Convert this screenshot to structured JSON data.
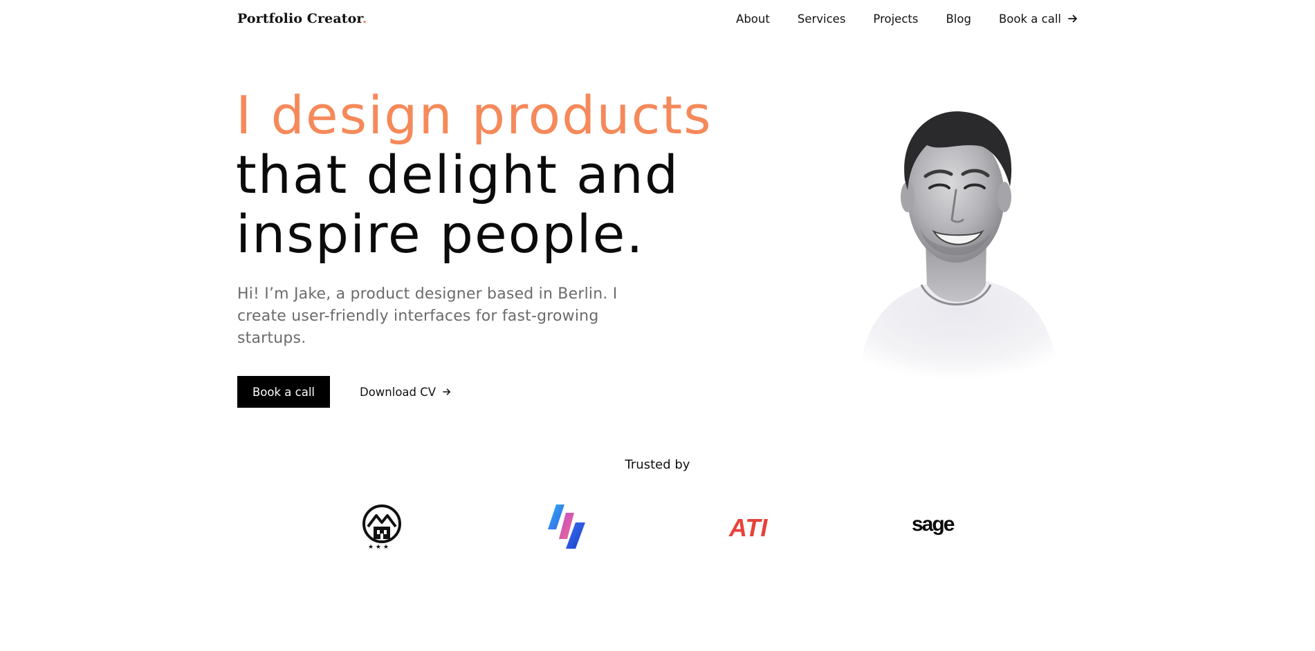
{
  "header": {
    "brand": "Portfolio Creator",
    "brand_dot": ".",
    "nav": [
      {
        "label": "About"
      },
      {
        "label": "Services"
      },
      {
        "label": "Projects"
      },
      {
        "label": "Blog"
      },
      {
        "label": "Book a call",
        "icon": "arrow-right-icon"
      }
    ]
  },
  "hero": {
    "title_accent": "I design products",
    "title_line2": "that delight and",
    "title_line3": "inspire people.",
    "subtitle": "Hi! I’m Jake, a product designer based in Berlin. I create user-friendly interfaces for fast-growing startups.",
    "primary_button": "Book a call",
    "secondary_button": "Download CV",
    "secondary_icon": "arrow-right-icon",
    "portrait": "portrait-photo"
  },
  "trusted": {
    "label": "Trusted by",
    "logos": [
      {
        "name": "mountain-house-logo"
      },
      {
        "name": "gradient-bolt-logo"
      },
      {
        "name": "ati-logo",
        "text": "ATI"
      },
      {
        "name": "sage-logo",
        "text": "sage"
      }
    ]
  },
  "colors": {
    "accent": "#f5895a",
    "ati_red": "#e8413a",
    "primary_button_bg": "#000000"
  }
}
